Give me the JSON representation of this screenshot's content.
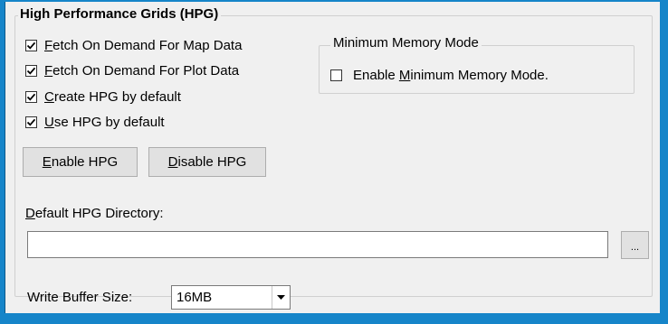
{
  "group": {
    "title": "High Performance Grids (HPG)"
  },
  "checkboxes": [
    {
      "pre": "",
      "ul": "F",
      "post": "etch On Demand For Map Data",
      "checked": true
    },
    {
      "pre": "",
      "ul": "F",
      "post": "etch On Demand For Plot Data",
      "checked": true
    },
    {
      "pre": "",
      "ul": "C",
      "post": "reate HPG by default",
      "checked": true
    },
    {
      "pre": "",
      "ul": "U",
      "post": "se HPG by default",
      "checked": true
    }
  ],
  "min_memory": {
    "title": "Minimum Memory Mode",
    "checkbox": {
      "pre": "Enable ",
      "ul": "M",
      "post": "inimum Memory Mode.",
      "checked": false
    }
  },
  "buttons": {
    "enable": {
      "ul": "E",
      "rest": "nable HPG"
    },
    "disable": {
      "ul": "D",
      "rest": "isable HPG"
    },
    "browse": "..."
  },
  "directory": {
    "label_ul": "D",
    "label_rest": "efault HPG Directory:",
    "value": ""
  },
  "write_buffer": {
    "label": "Write Buffer Size:",
    "selected": "16MB"
  }
}
